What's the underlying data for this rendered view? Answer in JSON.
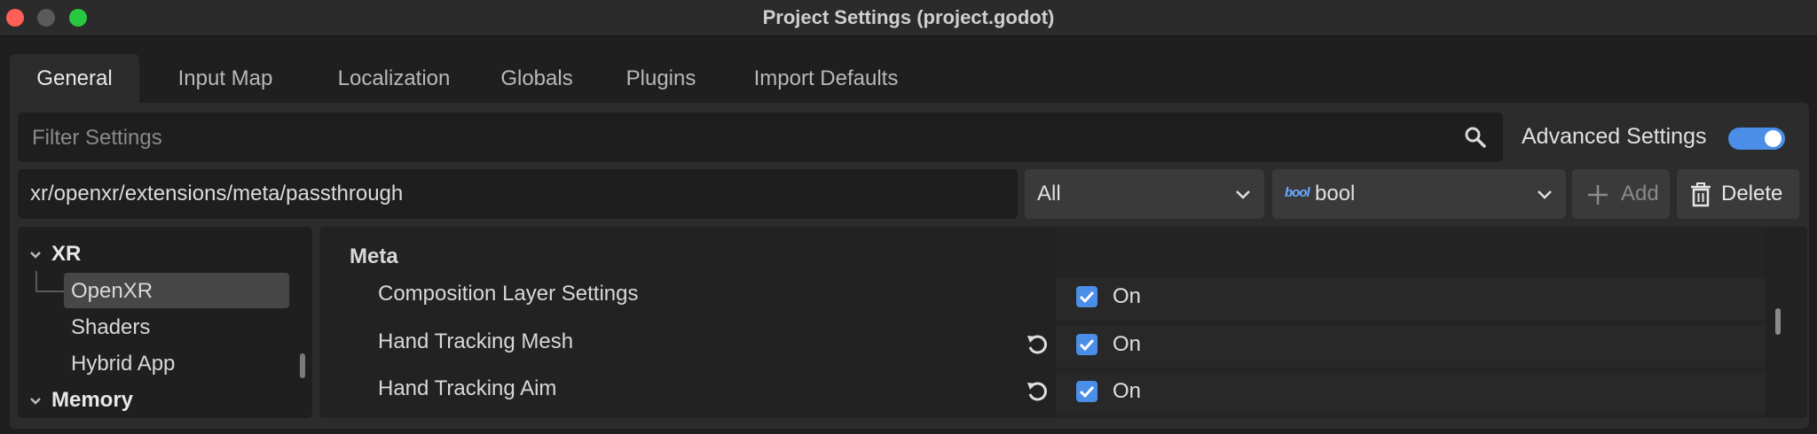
{
  "window": {
    "title": "Project Settings (project.godot)"
  },
  "tabs": [
    {
      "label": "General"
    },
    {
      "label": "Input Map"
    },
    {
      "label": "Localization"
    },
    {
      "label": "Globals"
    },
    {
      "label": "Plugins"
    },
    {
      "label": "Import Defaults"
    }
  ],
  "filter": {
    "placeholder": "Filter Settings"
  },
  "advanced": {
    "label": "Advanced Settings",
    "enabled": true
  },
  "add_bar": {
    "path": "xr/openxr/extensions/meta/passthrough",
    "scope": "All",
    "type_badge": "bool",
    "type": "bool",
    "add_label": "Add",
    "delete_label": "Delete"
  },
  "tree": {
    "items": [
      {
        "label": "XR"
      },
      {
        "label": "OpenXR"
      },
      {
        "label": "Shaders"
      },
      {
        "label": "Hybrid App"
      },
      {
        "label": "Memory"
      }
    ]
  },
  "inspector": {
    "section": "Meta",
    "properties": [
      {
        "name": "Composition Layer Settings",
        "value": "On"
      },
      {
        "name": "Hand Tracking Mesh",
        "value": "On"
      },
      {
        "name": "Hand Tracking Aim",
        "value": "On"
      }
    ]
  },
  "colors": {
    "accent": "#4a8ee8",
    "background": "#1f1f1f",
    "panel": "#2c2c2c"
  }
}
